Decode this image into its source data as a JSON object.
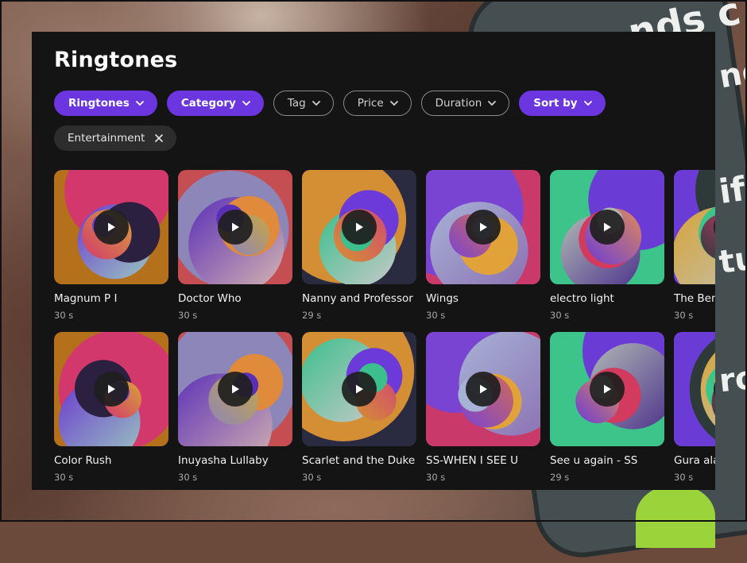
{
  "page": {
    "title": "Ringtones"
  },
  "filters": [
    {
      "label": "Ringtones",
      "style": "filled"
    },
    {
      "label": "Category",
      "style": "filled"
    },
    {
      "label": "Tag",
      "style": "outline"
    },
    {
      "label": "Price",
      "style": "outline"
    },
    {
      "label": "Duration",
      "style": "outline"
    },
    {
      "label": "Sort by",
      "style": "filled"
    }
  ],
  "active_tag": {
    "label": "Entertainment",
    "remove_icon": "close-icon"
  },
  "ringtones": [
    {
      "title": "Magnum P I",
      "duration": "30 s"
    },
    {
      "title": "Doctor Who",
      "duration": "30 s"
    },
    {
      "title": "Nanny and Professor",
      "duration": "29 s"
    },
    {
      "title": "Wings",
      "duration": "30 s"
    },
    {
      "title": "electro light",
      "duration": "30 s"
    },
    {
      "title": "The Ben",
      "duration": "30 s"
    },
    {
      "title": "Color Rush",
      "duration": "30 s"
    },
    {
      "title": "Inuyasha Lullaby",
      "duration": "30 s"
    },
    {
      "title": "Scarlet and the Duke",
      "duration": "30 s"
    },
    {
      "title": "SS-WHEN I SEE U",
      "duration": "30 s"
    },
    {
      "title": "See u again - SS",
      "duration": "29 s"
    },
    {
      "title": "Gura ala",
      "duration": "30 s"
    }
  ],
  "colors": {
    "accent": "#6b35e0",
    "panel_bg": "#141414",
    "chip_outline": "#8a8a8a",
    "tag_bg": "#2d2d2d",
    "muted_text": "#a8a8a8"
  },
  "icons": {
    "chevron": "chevron-down-icon",
    "play": "play-icon",
    "close": "close-icon"
  }
}
